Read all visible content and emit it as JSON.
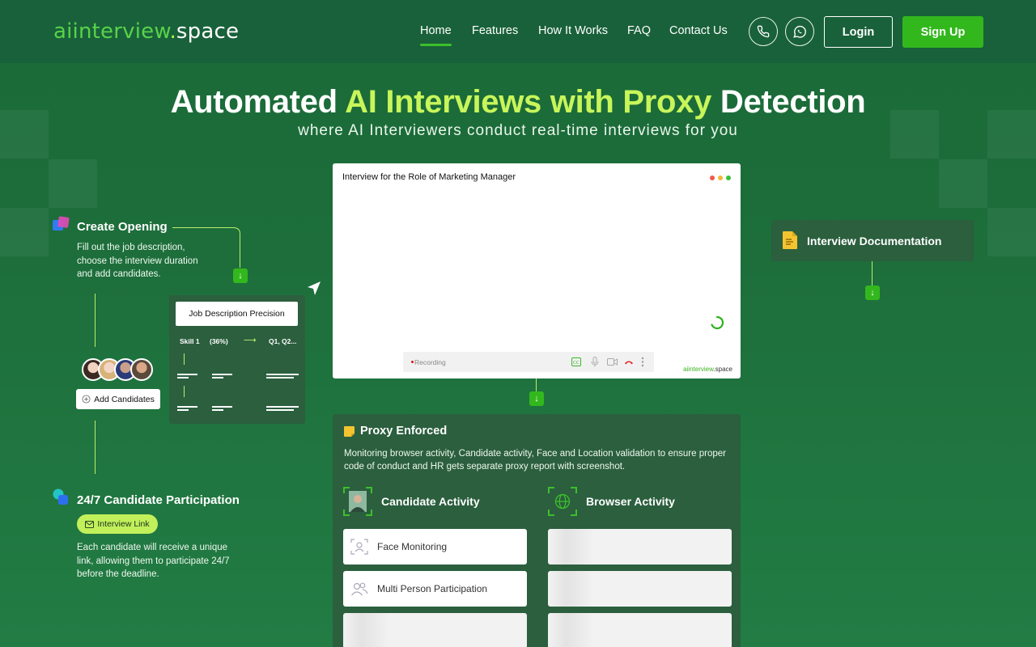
{
  "brand": {
    "logo_part1": "aiinterview",
    "logo_dot": ".",
    "logo_part2": "space"
  },
  "nav": {
    "items": [
      {
        "label": "Home",
        "active": true
      },
      {
        "label": "Features",
        "active": false
      },
      {
        "label": "How It Works",
        "active": false
      },
      {
        "label": "FAQ",
        "active": false
      },
      {
        "label": "Contact Us",
        "active": false
      }
    ],
    "phone_icon": "phone-icon",
    "whatsapp_icon": "whatsapp-icon",
    "login_label": "Login",
    "signup_label": "Sign Up"
  },
  "hero": {
    "title_part1": "Automated",
    "title_highlight": "AI Interviews with Proxy",
    "title_part2": "Detection",
    "subtitle": "where AI Interviewers conduct real-time interviews for you"
  },
  "steps": {
    "create_opening": {
      "title": "Create Opening",
      "description": "Fill out the job description, choose the interview duration and add candidates."
    },
    "job_description": {
      "button_label": "Job Description Precision",
      "col1": "Skill 1",
      "col2": "(36%)",
      "col3": "Q1, Q2..."
    },
    "add_candidates_label": "Add Candidates",
    "participation": {
      "title": "24/7 Candidate Participation",
      "link_label": "Interview Link",
      "description": "Each candidate will receive a unique link, allowing them to participate 24/7 before the deadline."
    },
    "documentation": {
      "title": "Interview Documentation"
    }
  },
  "video": {
    "title": "Interview for the Role of Marketing Manager",
    "recording_label": "Recording",
    "watermark_part1": "aiinterview",
    "watermark_part2": ".space"
  },
  "proxy": {
    "title": "Proxy Enforced",
    "description": "Monitoring browser activity, Candidate activity, Face and Location validation to ensure proper code of conduct and HR gets separate proxy report with screenshot.",
    "candidate_activity": {
      "title": "Candidate Activity",
      "items": [
        "Face Monitoring",
        "Multi Person Participation"
      ]
    },
    "browser_activity": {
      "title": "Browser Activity"
    }
  },
  "colors": {
    "background": "#1d6e3b",
    "accent_green": "#32b81d",
    "highlight": "#c8f55a",
    "card": "#2b5f3e"
  }
}
